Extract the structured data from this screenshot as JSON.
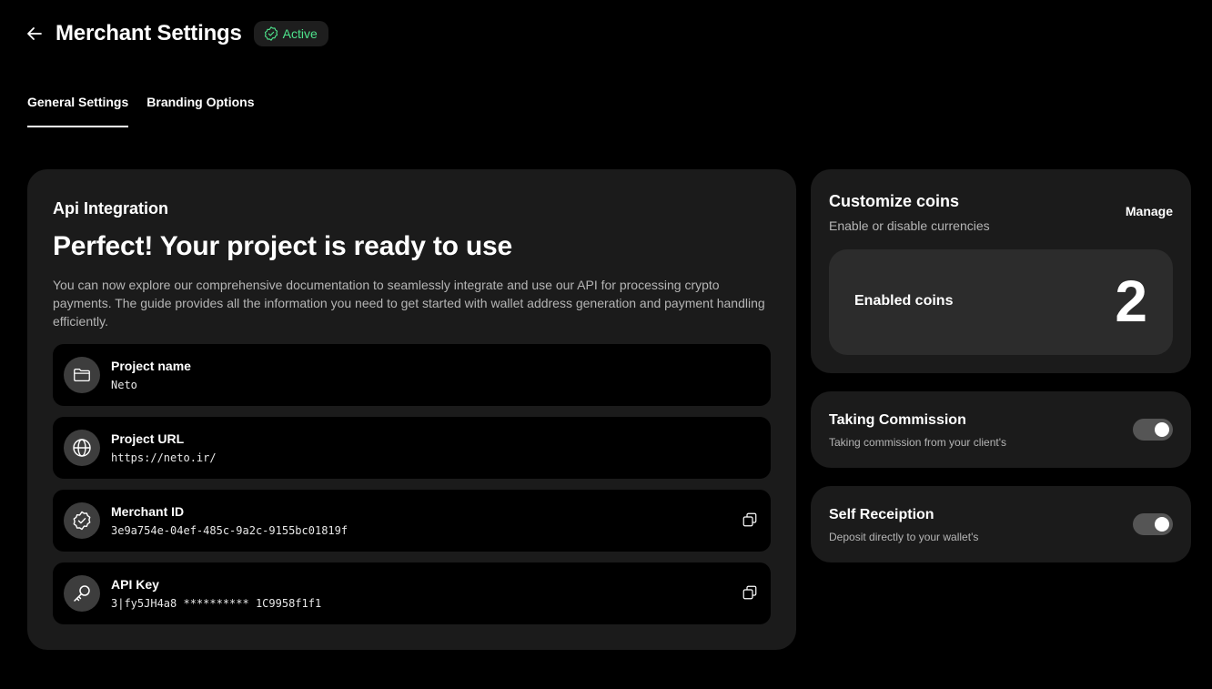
{
  "header": {
    "title": "Merchant Settings",
    "status": "Active",
    "back_icon": "arrow-left-icon"
  },
  "tabs": [
    {
      "label": "General Settings",
      "active": true
    },
    {
      "label": "Branding Options",
      "active": false
    }
  ],
  "api": {
    "kicker": "Api Integration",
    "headline": "Perfect! Your project is ready to use",
    "description": "You can now explore our comprehensive documentation to seamlessly integrate and use our API for processing crypto payments. The guide provides all the information you need to get started with wallet address generation and payment handling efficiently.",
    "rows": [
      {
        "label": "Project name",
        "value": "Neto",
        "icon": "folder-icon"
      },
      {
        "label": "Project URL",
        "value": "https://neto.ir/",
        "icon": "globe-icon"
      },
      {
        "label": "Merchant ID",
        "value": "3e9a754e-04ef-485c-9a2c-9155bc01819f",
        "icon": "verified-badge-icon"
      },
      {
        "label": "API Key",
        "value": "3|fy5JH4a8 ********** 1C9958f1f1",
        "icon": "key-icon"
      }
    ]
  },
  "coins": {
    "title": "Customize coins",
    "subtitle": "Enable or disable currencies",
    "manage_label": "Manage",
    "enabled_label": "Enabled coins",
    "enabled_count": "2"
  },
  "commission": {
    "title": "Taking Commission",
    "subtitle": "Taking commission from your client's",
    "enabled": true
  },
  "self_reception": {
    "title": "Self Receiption",
    "subtitle": "Deposit directly to your wallet's",
    "enabled": true
  },
  "colors": {
    "background": "#000000",
    "card": "#1b1b1b",
    "active_green": "#4ee38c"
  }
}
